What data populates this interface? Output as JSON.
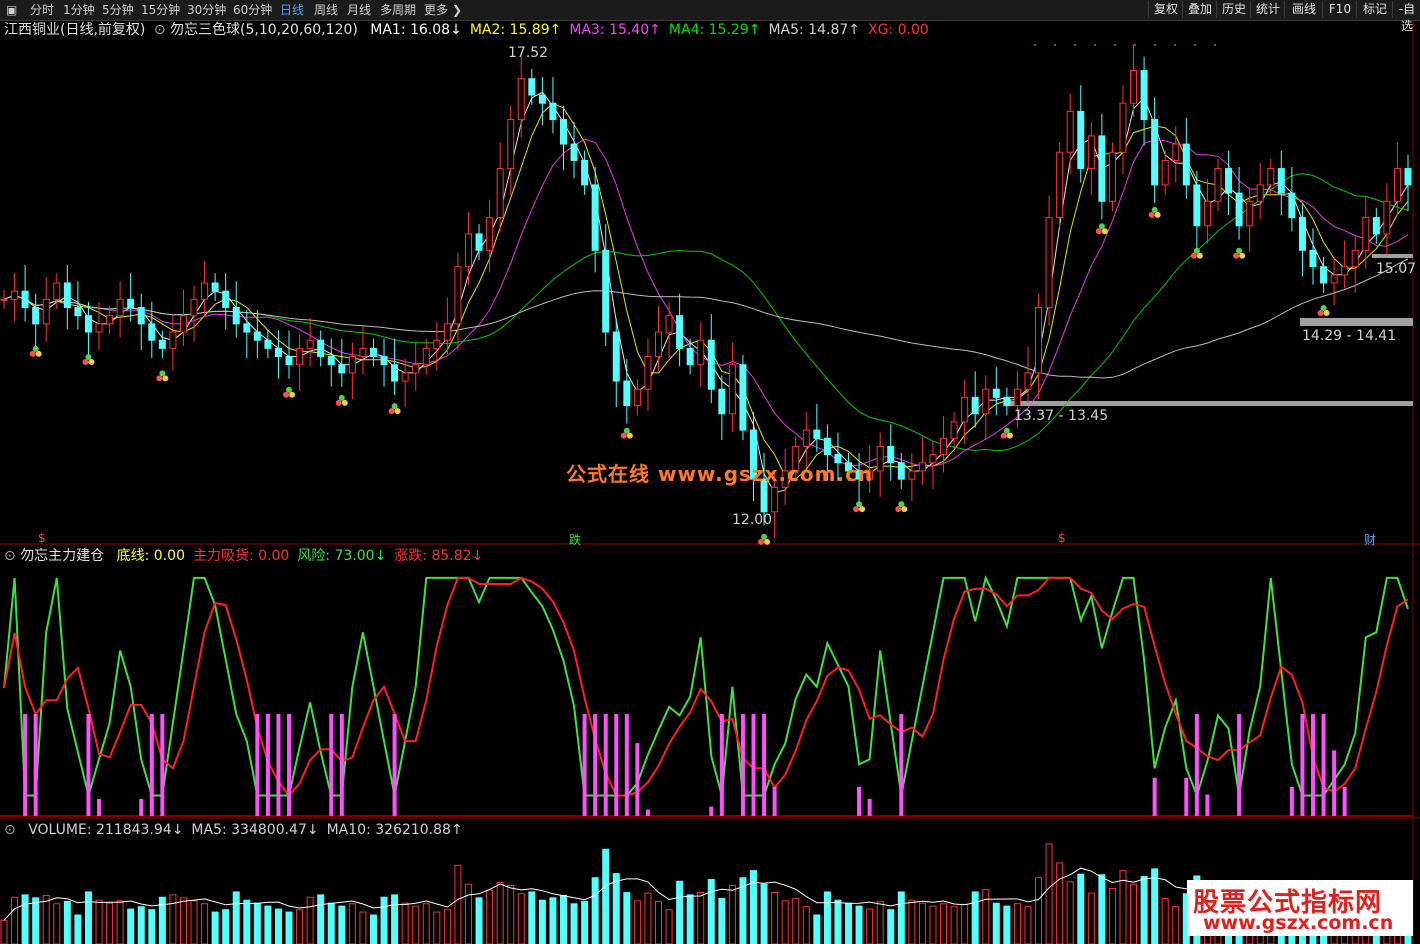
{
  "toolbar": {
    "tabs": [
      "分时",
      "1分钟",
      "5分钟",
      "15分钟",
      "30分钟",
      "60分钟",
      "日线",
      "周线",
      "月线",
      "多周期",
      "更多"
    ],
    "active_tab": "日线",
    "right_buttons": [
      "复权",
      "叠加",
      "历史",
      "统计",
      "画线",
      "F10",
      "标记",
      "-自选"
    ]
  },
  "main_panel": {
    "stock": "江西铜业(日线,前复权)",
    "indicator": "勿忘三色球(5,10,20,60,120)",
    "ma": [
      {
        "label": "MA1: 16.08",
        "arrow": "↓",
        "color": "#ffffff"
      },
      {
        "label": "MA2: 15.89",
        "arrow": "↑",
        "color": "#ffff00"
      },
      {
        "label": "MA3: 15.40",
        "arrow": "↑",
        "color": "#ff40ff"
      },
      {
        "label": "MA4: 15.29",
        "arrow": "↑",
        "color": "#00e000"
      },
      {
        "label": "MA5: 14.87",
        "arrow": "↑",
        "color": "#d0d0d0"
      },
      {
        "label": "XG: 0.00",
        "arrow": "",
        "color": "#ff3030"
      }
    ],
    "high_label": "17.52",
    "low_label": "12.00",
    "price_tags": [
      "15.07"
    ],
    "zones": [
      "14.29 - 14.41",
      "13.37 - 13.45"
    ],
    "event_markers": [
      "$",
      "跌",
      "$",
      "财"
    ],
    "watermark": "公式在线  www.gszx.com.cn"
  },
  "indicator_panel": {
    "name": "勿忘主力建仓",
    "values": [
      {
        "label": "底线: 0.00",
        "color": "#ffff40"
      },
      {
        "label": "主力吸货: 0.00",
        "color": "#ff3030"
      },
      {
        "label": "风险: 73.00",
        "arrow": "↓",
        "color": "#40e040"
      },
      {
        "label": "涨跌: 85.82",
        "arrow": "↓",
        "color": "#ff3030"
      }
    ]
  },
  "volume_panel": {
    "values": [
      {
        "label": "VOLUME: 211843.94",
        "arrow": "↓",
        "color": "#d0d0d0"
      },
      {
        "label": "MA5: 334800.47",
        "arrow": "↓",
        "color": "#d0d0d0"
      },
      {
        "label": "MA10: 326210.88",
        "arrow": "↑",
        "color": "#d0d0d0"
      }
    ]
  },
  "brand_watermark": {
    "line1": "股票公式指标网",
    "line2": "www.gszx.com.cn"
  },
  "chart_data": {
    "type": "candlestick",
    "close": [
      14.6,
      14.7,
      14.5,
      14.3,
      14.6,
      14.8,
      14.5,
      14.4,
      14.2,
      14.3,
      14.4,
      14.6,
      14.5,
      14.3,
      14.1,
      14.0,
      14.2,
      14.4,
      14.6,
      14.8,
      14.7,
      14.5,
      14.3,
      14.2,
      14.1,
      14.0,
      13.9,
      13.8,
      14.0,
      14.1,
      13.9,
      13.8,
      13.7,
      13.9,
      14.0,
      13.9,
      13.8,
      13.6,
      13.7,
      13.8,
      14.0,
      14.1,
      14.3,
      15.0,
      15.4,
      15.2,
      15.6,
      16.2,
      16.8,
      17.3,
      17.1,
      17.0,
      16.8,
      16.5,
      16.3,
      16.0,
      15.2,
      14.2,
      13.6,
      13.3,
      13.5,
      13.9,
      14.2,
      14.4,
      14.0,
      13.8,
      14.1,
      13.5,
      13.2,
      13.8,
      13.0,
      12.4,
      12.0,
      12.3,
      12.5,
      12.8,
      13.0,
      12.9,
      12.7,
      12.6,
      12.5,
      12.4,
      12.5,
      12.8,
      12.6,
      12.4,
      12.5,
      12.6,
      12.7,
      12.9,
      13.1,
      13.4,
      13.2,
      13.5,
      13.4,
      13.3,
      13.5,
      13.7,
      14.5,
      15.6,
      16.4,
      16.9,
      16.2,
      16.6,
      15.8,
      16.4,
      17.0,
      17.4,
      16.8,
      16.0,
      16.3,
      16.5,
      16.0,
      15.5,
      15.8,
      16.2,
      15.9,
      15.5,
      15.8,
      16.0,
      16.2,
      15.9,
      15.6,
      15.2,
      15.0,
      14.8,
      14.9,
      15.0,
      15.2,
      15.6,
      15.4,
      15.8,
      16.2,
      16.0
    ],
    "ma_labels": [
      "MA1",
      "MA2",
      "MA3",
      "MA4",
      "MA5"
    ],
    "price_range": [
      11.9,
      17.7
    ],
    "indicator_range": [
      0,
      100
    ],
    "volume_series": "VOLUME"
  }
}
